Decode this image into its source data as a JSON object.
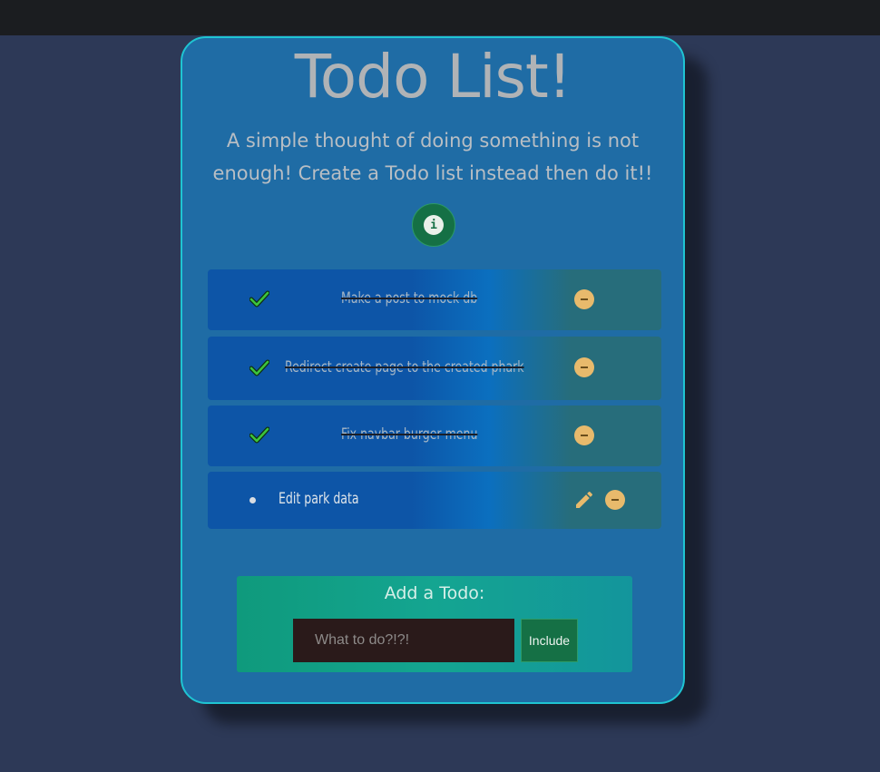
{
  "header": {
    "title": "Todo List!",
    "subtitle_line1": "A simple thought of doing something is not",
    "subtitle_line2": "enough! Create a Todo list instead then do it!!",
    "info_icon": "info-icon",
    "info_glyph": "i"
  },
  "todos": [
    {
      "text": "Make a post to mock db",
      "completed": true
    },
    {
      "text": "Redirect create page to the created phark",
      "completed": true
    },
    {
      "text": "Fix navbar burger menu",
      "completed": true
    },
    {
      "text": "Edit park data",
      "completed": false
    }
  ],
  "add_form": {
    "label": "Add a Todo:",
    "placeholder": "What to do?!?!",
    "value": "",
    "submit_label": "Include"
  },
  "colors": {
    "page_background": "#2d3957",
    "card_background": "#1f6ca5",
    "card_border": "#1fc4d2",
    "check_green": "#3cc43c",
    "action_yellow": "#e8ba6c",
    "button_green": "#157045"
  }
}
